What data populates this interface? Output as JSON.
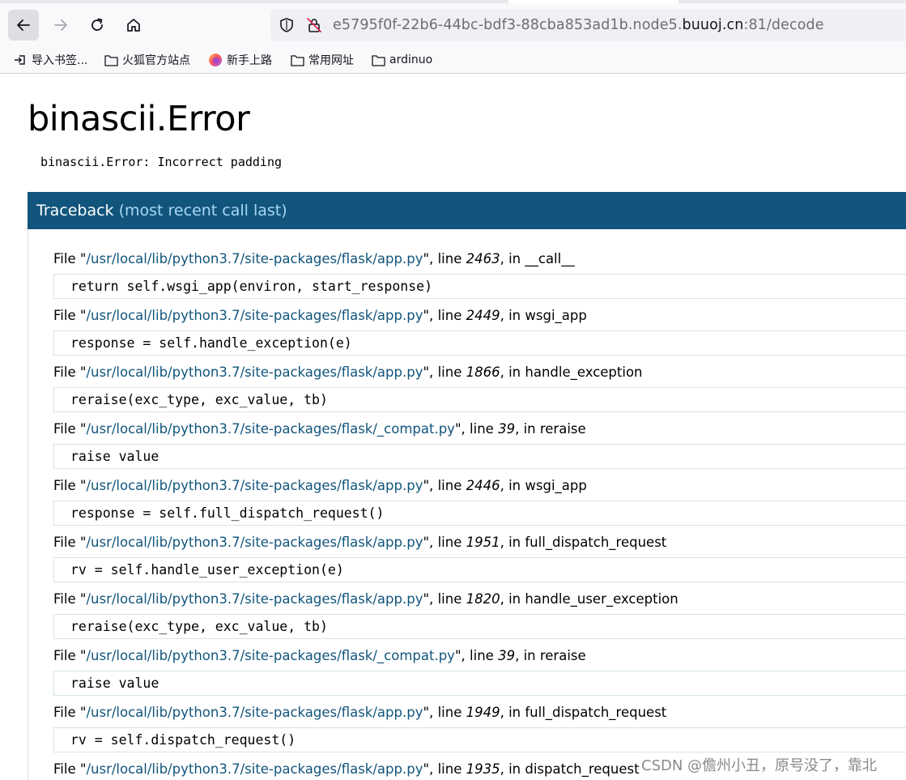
{
  "browser": {
    "url_prefix": "e5795f0f-22b6-44bc-bdf3-88cba853ad1b.node5.",
    "url_domain": "buuoj.cn",
    "url_suffix": ":81/decode",
    "bookmarks": [
      {
        "label": "导入书签...",
        "icon": "import-icon"
      },
      {
        "label": "火狐官方站点",
        "icon": "folder-icon"
      },
      {
        "label": "新手上路",
        "icon": "firefox-icon"
      },
      {
        "label": "常用网址",
        "icon": "folder-icon"
      },
      {
        "label": "ardinuo",
        "icon": "folder-icon"
      }
    ]
  },
  "page": {
    "title": "binascii.Error",
    "error_message": "binascii.Error: Incorrect padding",
    "traceback_label": "Traceback",
    "traceback_sub": "(most recent call last)"
  },
  "frames": [
    {
      "path": "/usr/local/lib/python3.7/site-packages/flask/app.py",
      "line": "2463",
      "func": "__call__",
      "code": "return self.wsgi_app(environ, start_response)"
    },
    {
      "path": "/usr/local/lib/python3.7/site-packages/flask/app.py",
      "line": "2449",
      "func": "wsgi_app",
      "code": "response = self.handle_exception(e)"
    },
    {
      "path": "/usr/local/lib/python3.7/site-packages/flask/app.py",
      "line": "1866",
      "func": "handle_exception",
      "code": "reraise(exc_type, exc_value, tb)"
    },
    {
      "path": "/usr/local/lib/python3.7/site-packages/flask/_compat.py",
      "line": "39",
      "func": "reraise",
      "code": "raise value"
    },
    {
      "path": "/usr/local/lib/python3.7/site-packages/flask/app.py",
      "line": "2446",
      "func": "wsgi_app",
      "code": "response = self.full_dispatch_request()"
    },
    {
      "path": "/usr/local/lib/python3.7/site-packages/flask/app.py",
      "line": "1951",
      "func": "full_dispatch_request",
      "code": "rv = self.handle_user_exception(e)"
    },
    {
      "path": "/usr/local/lib/python3.7/site-packages/flask/app.py",
      "line": "1820",
      "func": "handle_user_exception",
      "code": "reraise(exc_type, exc_value, tb)"
    },
    {
      "path": "/usr/local/lib/python3.7/site-packages/flask/_compat.py",
      "line": "39",
      "func": "reraise",
      "code": "raise value"
    },
    {
      "path": "/usr/local/lib/python3.7/site-packages/flask/app.py",
      "line": "1949",
      "func": "full_dispatch_request",
      "code": "rv = self.dispatch_request()"
    },
    {
      "path": "/usr/local/lib/python3.7/site-packages/flask/app.py",
      "line": "1935",
      "func": "dispatch_request",
      "code": ""
    }
  ],
  "frame_words": {
    "file": "File",
    "line": "line",
    "in": "in"
  },
  "watermark": "CSDN @儋州小丑，原号没了，靠北",
  "colors": {
    "header_bg": "#11557c",
    "header_sub": "#a9d7f4",
    "path": "#11557c"
  }
}
